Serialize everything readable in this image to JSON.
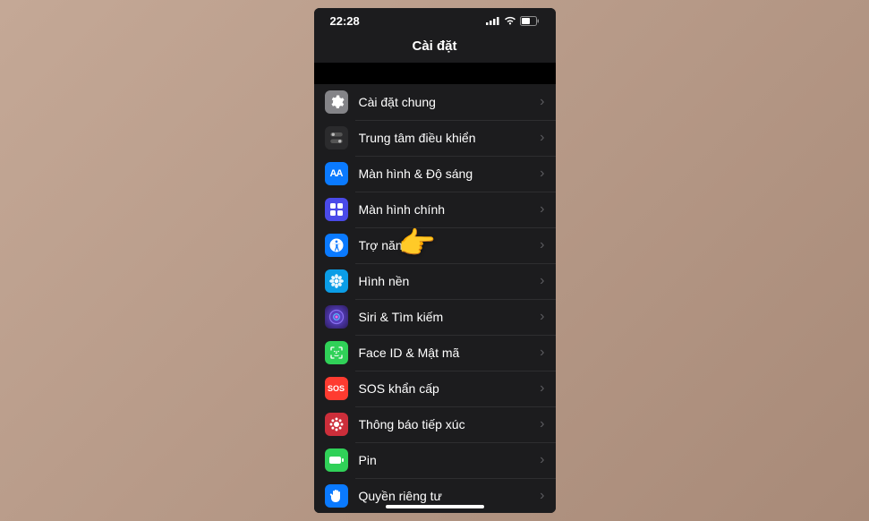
{
  "status": {
    "time": "22:28"
  },
  "title": "Cài đặt",
  "pointer_row_index": 4,
  "rows": [
    {
      "key": "general",
      "label": "Cài đặt chung",
      "icon": "gear",
      "bg": "bg-gray"
    },
    {
      "key": "control-center",
      "label": "Trung tâm điều khiển",
      "icon": "switches",
      "bg": "bg-cc"
    },
    {
      "key": "display",
      "label": "Màn hình & Độ sáng",
      "icon": "aa",
      "bg": "bg-blue"
    },
    {
      "key": "home-screen",
      "label": "Màn hình chính",
      "icon": "grid",
      "bg": "bg-purple"
    },
    {
      "key": "accessibility",
      "label": "Trợ năng",
      "icon": "access",
      "bg": "bg-blue2"
    },
    {
      "key": "wallpaper",
      "label": "Hình nền",
      "icon": "flower",
      "bg": "bg-cyan"
    },
    {
      "key": "siri",
      "label": "Siri & Tìm kiếm",
      "icon": "siri",
      "bg": "bg-siri"
    },
    {
      "key": "faceid",
      "label": "Face ID & Mật mã",
      "icon": "face",
      "bg": "bg-green"
    },
    {
      "key": "sos",
      "label": "SOS khẩn cấp",
      "icon": "sos",
      "bg": "bg-red"
    },
    {
      "key": "exposure",
      "label": "Thông báo tiếp xúc",
      "icon": "exposure",
      "bg": "bg-expo"
    },
    {
      "key": "battery",
      "label": "Pin",
      "icon": "battery",
      "bg": "bg-battery"
    },
    {
      "key": "privacy",
      "label": "Quyền riêng tư",
      "icon": "hand",
      "bg": "bg-hand"
    }
  ]
}
